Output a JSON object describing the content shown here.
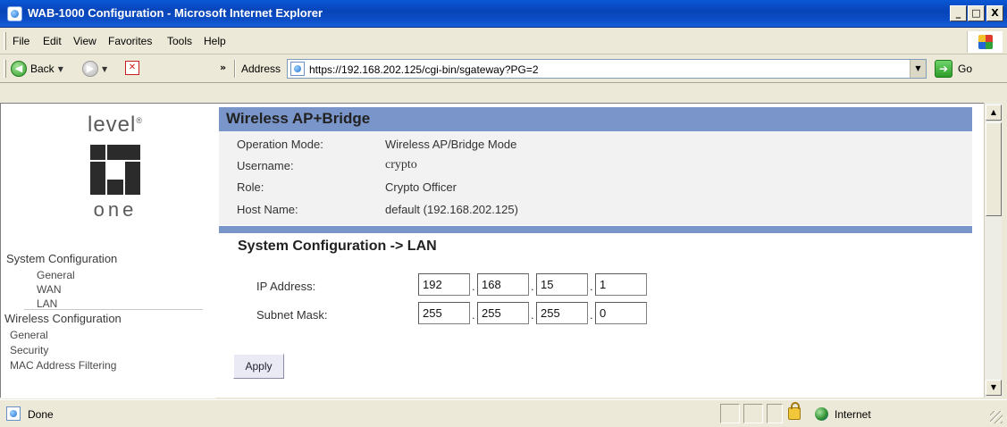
{
  "window": {
    "title": "WAB-1000 Configuration - Microsoft Internet Explorer",
    "min_label": "_",
    "max_label": "□",
    "close_label": "X"
  },
  "menu": {
    "items": [
      "File",
      "Edit",
      "View",
      "Favorites",
      "Tools",
      "Help"
    ]
  },
  "toolbar": {
    "back_label": "Back",
    "more_label": "»",
    "address_label": "Address",
    "url": "https://192.168.202.125/cgi-bin/sgateway?PG=2",
    "go_label": "Go"
  },
  "sidebar": {
    "logo_top": "level",
    "logo_bottom": "one",
    "system_header": "System Configuration",
    "system_items": [
      "General",
      "WAN",
      "LAN"
    ],
    "wireless_header": "Wireless Configuration",
    "wireless_items": [
      "General",
      "Security",
      "MAC Address Filtering"
    ]
  },
  "info": {
    "header": "Wireless AP+Bridge",
    "rows": [
      {
        "label": "Operation Mode:",
        "value": "Wireless AP/Bridge Mode"
      },
      {
        "label": "Username:",
        "value": "crypto"
      },
      {
        "label": "Role:",
        "value": "Crypto Officer"
      },
      {
        "label": "Host Name:",
        "value": "default (192.168.202.125)"
      }
    ]
  },
  "lan": {
    "title": "System Configuration -> LAN",
    "ip_label": "IP Address:",
    "ip": [
      "192",
      "168",
      "15",
      "1"
    ],
    "mask_label": "Subnet Mask:",
    "mask": [
      "255",
      "255",
      "255",
      "0"
    ],
    "apply_label": "Apply"
  },
  "status": {
    "text": "Done",
    "zone": "Internet"
  },
  "colors": {
    "section_bar": "#7a95c9",
    "info_background": "#f2f2f2",
    "title_bar": "#0843b8"
  }
}
